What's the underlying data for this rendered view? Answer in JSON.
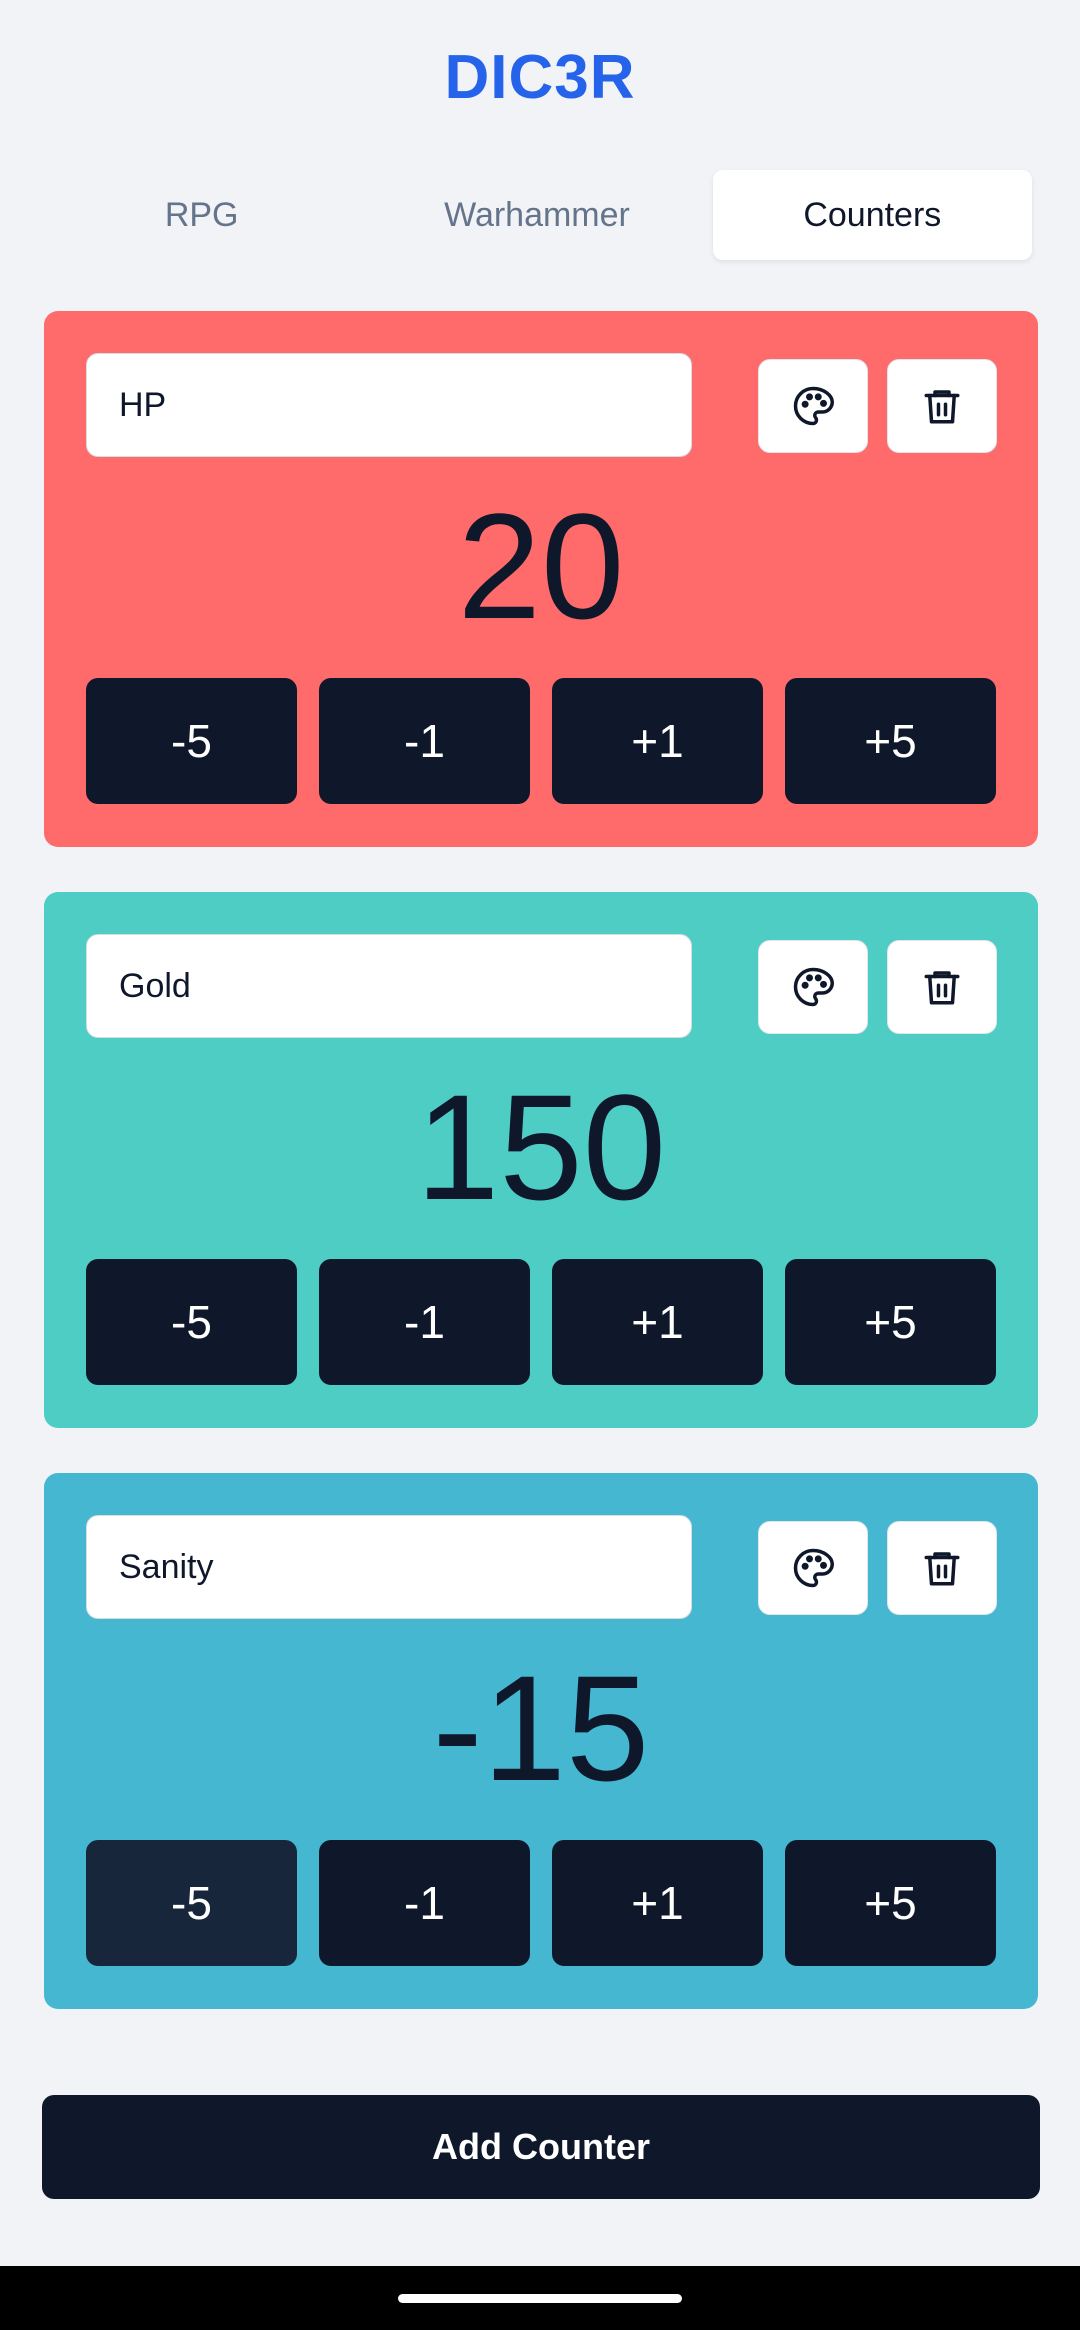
{
  "app": {
    "title": "DIC3R"
  },
  "tabs": [
    {
      "label": "RPG",
      "active": false
    },
    {
      "label": "Warhammer",
      "active": false
    },
    {
      "label": "Counters",
      "active": true
    }
  ],
  "counters": [
    {
      "name": "HP",
      "value": "20",
      "color": "#ff6b6b",
      "buttons": [
        "-5",
        "-1",
        "+1",
        "+5"
      ]
    },
    {
      "name": "Gold",
      "value": "150",
      "color": "#4ecdc4",
      "buttons": [
        "-5",
        "-1",
        "+1",
        "+5"
      ]
    },
    {
      "name": "Sanity",
      "value": "-15",
      "color": "#45b7d1",
      "buttons": [
        "-5",
        "-1",
        "+1",
        "+5"
      ]
    }
  ],
  "icons": {
    "palette": "palette-icon",
    "delete": "trash-icon"
  },
  "add_button": {
    "label": "Add Counter"
  },
  "colors": {
    "accent": "#2563eb",
    "dark": "#0f172a",
    "background": "#f1f3f6"
  }
}
